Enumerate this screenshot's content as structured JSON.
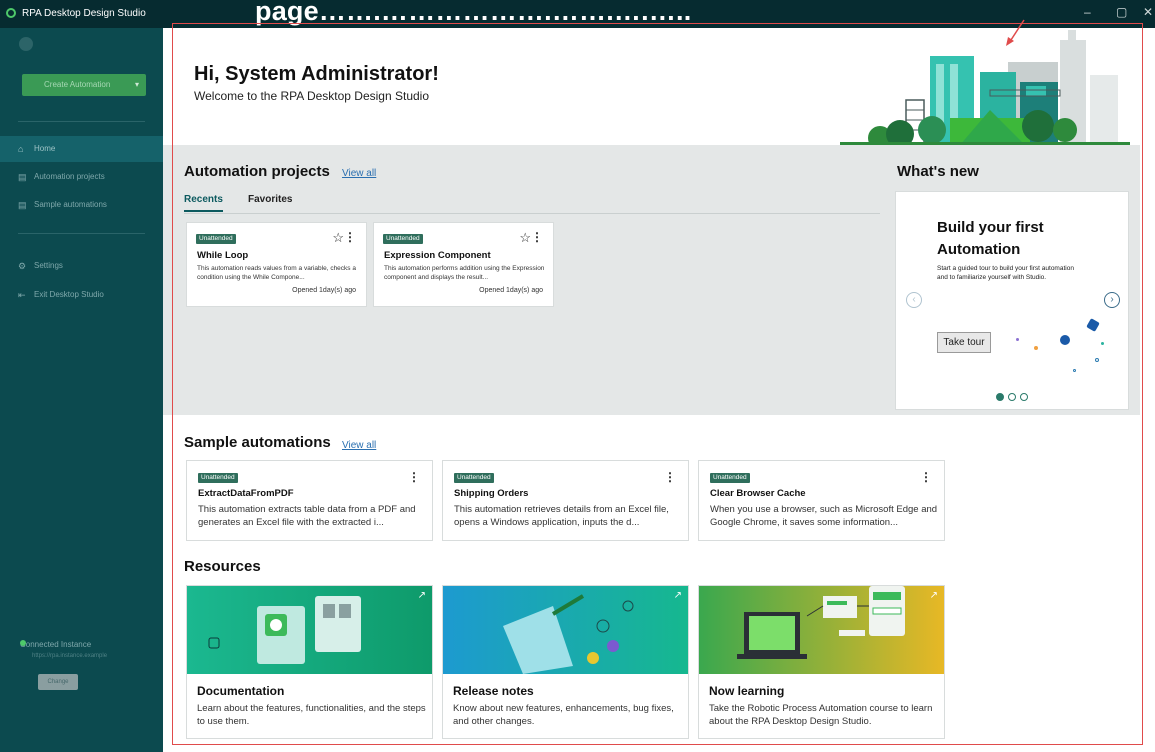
{
  "window": {
    "title": "RPA Desktop Design Studio",
    "minimize": "–",
    "maximize": "▢",
    "close": "✕"
  },
  "overlay_caption": "page…….……………….…….….…..",
  "sidebar": {
    "create_button": "Create Automation",
    "create_caret": "▾",
    "items": [
      {
        "label": "Home",
        "icon": "home-icon",
        "glyph": "⌂"
      },
      {
        "label": "Automation projects",
        "icon": "projects-icon",
        "glyph": "▤"
      },
      {
        "label": "Sample automations",
        "icon": "samples-icon",
        "glyph": "▤"
      },
      {
        "label": "Settings",
        "icon": "gear-icon",
        "glyph": "⚙"
      },
      {
        "label": "Exit Desktop Studio",
        "icon": "exit-icon",
        "glyph": "⇤"
      }
    ],
    "connected_label": "Connected Instance",
    "connected_sub": "https://rpa.instance.example",
    "change_button": "Change"
  },
  "header": {
    "greeting": "Hi, System Administrator!",
    "welcome": "Welcome to the RPA Desktop Design Studio"
  },
  "projects": {
    "title": "Automation projects",
    "view_all": "View all",
    "tabs": [
      "Recents",
      "Favorites"
    ],
    "cards": [
      {
        "badge": "Unattended",
        "name": "While Loop",
        "desc": "This automation reads values from a variable, checks a condition using the While Compone...",
        "opened": "Opened 1day(s) ago"
      },
      {
        "badge": "Unattended",
        "name": "Expression Component",
        "desc": "This automation performs addition using the Expression component and displays the result...",
        "opened": "Opened 1day(s) ago"
      }
    ]
  },
  "whats_new": {
    "title": "What's new",
    "heading": "Build your first Automation",
    "desc": "Start a guided tour to build your first automation and to familiarize yourself with Studio.",
    "button": "Take tour",
    "prev": "‹",
    "next": "›"
  },
  "samples": {
    "title": "Sample automations",
    "view_all": "View all",
    "cards": [
      {
        "badge": "Unattended",
        "name": "ExtractDataFromPDF",
        "desc": "This automation extracts table data from a PDF and generates an Excel file with the extracted i..."
      },
      {
        "badge": "Unattended",
        "name": "Shipping Orders",
        "desc": "This automation retrieves details from an Excel file, opens a Windows application, inputs the d..."
      },
      {
        "badge": "Unattended",
        "name": "Clear Browser Cache",
        "desc": "When you use a browser, such as Microsoft Edge and Google Chrome, it saves some information..."
      }
    ]
  },
  "resources": {
    "title": "Resources",
    "cards": [
      {
        "name": "Documentation",
        "desc": "Learn about the features, functionalities, and the steps to use them."
      },
      {
        "name": "Release notes",
        "desc": "Know about new features, enhancements, bug fixes, and other changes."
      },
      {
        "name": "Now learning",
        "desc": "Take the Robotic Process Automation course to learn about the RPA Desktop Design Studio."
      }
    ]
  },
  "colors": {
    "sidebar": "#0c4a4f",
    "titlebar": "#062b30",
    "badge": "#2f6e5c",
    "accent": "#0c5a5f",
    "highlight_frame": "#e04b4b"
  }
}
